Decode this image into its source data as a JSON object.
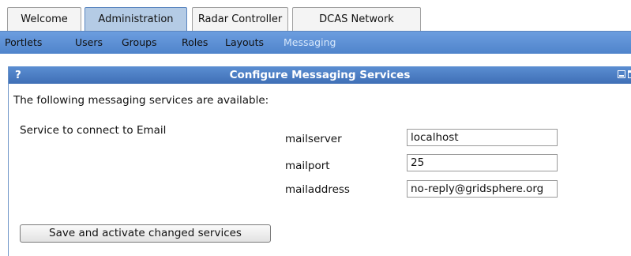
{
  "tabs": [
    {
      "label": "Welcome",
      "active": false
    },
    {
      "label": "Administration",
      "active": true
    },
    {
      "label": "Radar Controller",
      "active": false
    },
    {
      "label": "DCAS Network",
      "active": false
    }
  ],
  "subnav": [
    {
      "label": "Portlets",
      "active": false
    },
    {
      "label": "Users",
      "active": false
    },
    {
      "label": "Groups",
      "active": false
    },
    {
      "label": "Roles",
      "active": false
    },
    {
      "label": "Layouts",
      "active": false
    },
    {
      "label": "Messaging",
      "active": true
    }
  ],
  "portlet": {
    "help": "?",
    "title": "Configure Messaging Services",
    "intro": "The following messaging services are available:",
    "service_description": "Service to connect to Email",
    "fields": [
      {
        "label": "mailserver",
        "value": "localhost"
      },
      {
        "label": "mailport",
        "value": "25"
      },
      {
        "label": "mailaddress",
        "value": "no-reply@gridsphere.org"
      }
    ],
    "save_label": "Save and activate changed services"
  },
  "colors": {
    "accent": "#4a7cc2",
    "subnav": "#5b8fd2",
    "active_tab": "#b4cbe5",
    "active_subnav_text": "#d6e7fb"
  }
}
